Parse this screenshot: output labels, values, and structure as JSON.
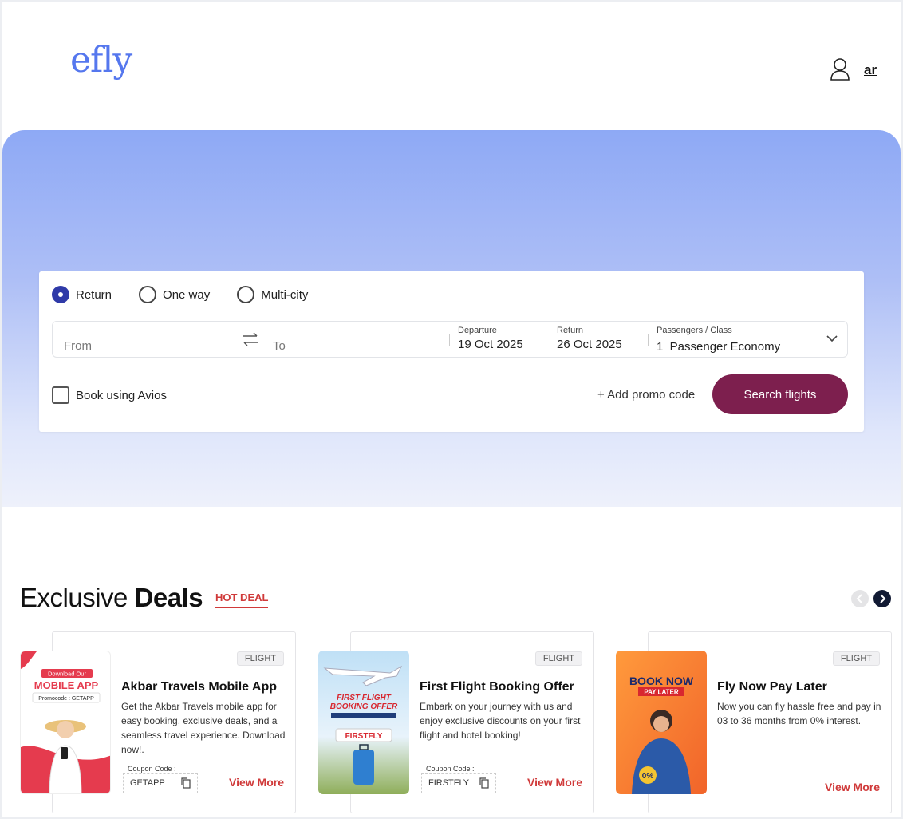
{
  "header": {
    "logo": "efly",
    "language_link": "ar"
  },
  "search": {
    "trip_types": [
      {
        "label": "Return",
        "selected": true
      },
      {
        "label": "One way",
        "selected": false
      },
      {
        "label": "Multi-city",
        "selected": false
      }
    ],
    "from_placeholder": "From",
    "to_placeholder": "To",
    "departure_label": "Departure",
    "departure_value": "19 Oct 2025",
    "return_label": "Return",
    "return_value": "26 Oct 2025",
    "passengers_label": "Passengers / Class",
    "passengers_value": "1  Passenger Economy",
    "avios_label": "Book using Avios",
    "promo_label": "+ Add promo code",
    "search_button": "Search flights"
  },
  "deals": {
    "title_light": "Exclusive",
    "title_bold": "Deals",
    "tab": "HOT DEAL",
    "cards": [
      {
        "tag": "FLIGHT",
        "title": "Akbar Travels Mobile App",
        "description": "Get the Akbar Travels mobile app for easy booking, exclusive deals, and a seamless travel experience. Download now!.",
        "coupon_label": "Coupon Code :",
        "coupon_code": "GETAPP",
        "view_more": "View More",
        "image_text_1": "Download Our",
        "image_text_2": "MOBILE APP",
        "image_text_3": "Promocode : GETAPP"
      },
      {
        "tag": "FLIGHT",
        "title": "First Flight Booking Offer",
        "description": "Embark on your journey with us and enjoy exclusive discounts on your first flight and hotel booking!",
        "coupon_label": "Coupon Code :",
        "coupon_code": "FIRSTFLY",
        "view_more": "View More",
        "image_text_1": "FIRST FLIGHT",
        "image_text_2": "BOOKING OFFER",
        "image_text_3": "FIRSTFLY"
      },
      {
        "tag": "FLIGHT",
        "title": "Fly Now Pay Later",
        "description": "Now you can fly hassle free and pay in 03 to 36 months from 0% interest.",
        "view_more": "View More",
        "image_text_1": "BOOK NOW",
        "image_text_2": "PAY LATER",
        "image_text_3": "0%"
      }
    ]
  },
  "colors": {
    "brand_logo": "#5577ee",
    "search_button": "#7d1f4e",
    "hot_deal": "#d03a3a",
    "radio_selected": "#2f3aa8"
  }
}
